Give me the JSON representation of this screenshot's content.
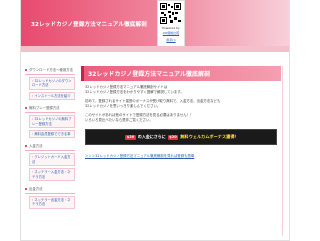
{
  "header": {
    "title": "32レッドカジノ登録方法マニュアル徹底解剖",
    "qr_caption_top": "Powered by",
    "qr_caption_link": "QR価格比較",
    "qr_caption_bottom": "携帯(i)"
  },
  "sidebar": {
    "groups": [
      {
        "heading": "ダウンロード方法〜使用方法",
        "items": [
          "32レッドカジノのダウンロード方法",
          "インストール方法を紹介"
        ]
      },
      {
        "heading": "無料プレー登録方法",
        "items": [
          "32レッドカジノの無料プレー登録方法",
          "無料会員登録でできる事"
        ]
      },
      {
        "heading": "入金方法",
        "items": [
          "クレジットカード入金方法",
          "ネッテラー入金方法・ネテラ方法"
        ]
      },
      {
        "heading": "出金方法",
        "items": [
          "ネッテラー出金方法・ネテラ方法"
        ]
      }
    ]
  },
  "main": {
    "page_title": "32レッドカジノ登録方法マニュアル徹底解剖",
    "paragraphs": [
      "32レッドカジノ登録方法マニュアル徹底解剖サイトは",
      "32レッドカジノ登録方法をわかりやすく図解で解説しています。",
      "初めて、登録されるサイト運営のポーナスが受け取り無料で、入金方法、出金方法なども",
      "32レッドカジノを思いっきり楽しんでください。",
      "このサイトがあれば他のサイトで登録方法を見る必要はありません！！",
      "いろいろ見比べたいなら是非ご覧ください。"
    ],
    "banner": {
      "left_text": "の入金にさらに",
      "badge_left": "$20",
      "badge_right": "$20",
      "right_text": "無料ウェルカムボーナス獲得！"
    },
    "link_text": "＞＞＞32レッドカジノ登録方法マニュアル徹底解剖を見れば登録も簡単"
  },
  "colors": {
    "accent": "#e84a6e",
    "link": "#2a5db0",
    "banner_bg": "#1a1a1a",
    "banner_highlight": "#ffdf40"
  }
}
